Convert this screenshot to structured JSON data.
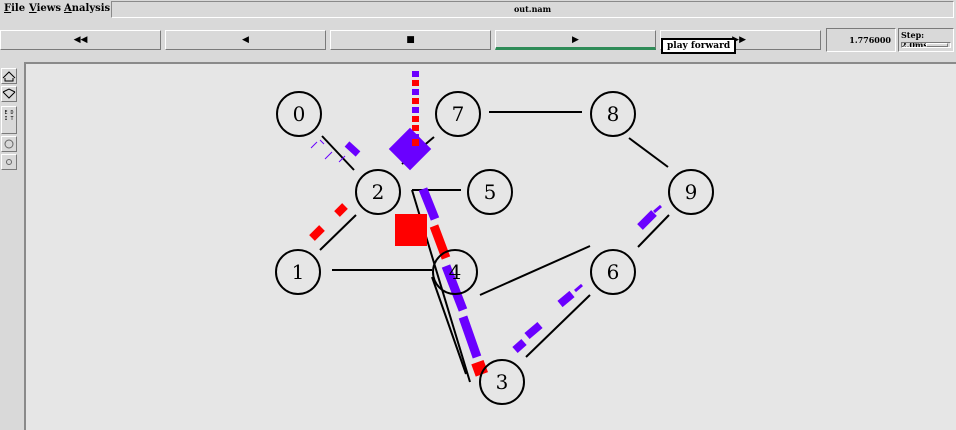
{
  "menu": {
    "file": "File",
    "views": "Views",
    "analysis": "Analysis"
  },
  "window": {
    "title": "out.nam"
  },
  "toolbar": {
    "rewind": "◀◀",
    "back": "◀",
    "stop": "■",
    "play": "▶",
    "fast_forward": "▶▶",
    "time": "1.776000",
    "step_label": "Step: 2.0ms",
    "tooltip": "play forward"
  },
  "colors": {
    "link": "#000000",
    "packet_red": "#ff0000",
    "packet_blue": "#6a00ff",
    "active_button": "#2e8b57"
  },
  "nodes": [
    {
      "id": "0",
      "label": "0"
    },
    {
      "id": "1",
      "label": "1"
    },
    {
      "id": "2",
      "label": "2"
    },
    {
      "id": "3",
      "label": "3"
    },
    {
      "id": "4",
      "label": "4"
    },
    {
      "id": "5",
      "label": "5"
    },
    {
      "id": "6",
      "label": "6"
    },
    {
      "id": "7",
      "label": "7"
    },
    {
      "id": "8",
      "label": "8"
    },
    {
      "id": "9",
      "label": "9"
    }
  ],
  "links": [
    [
      "0",
      "2"
    ],
    [
      "1",
      "2"
    ],
    [
      "1",
      "4"
    ],
    [
      "2",
      "5"
    ],
    [
      "2",
      "7"
    ],
    [
      "2",
      "3"
    ],
    [
      "7",
      "8"
    ],
    [
      "8",
      "9"
    ],
    [
      "9",
      "6"
    ],
    [
      "6",
      "4"
    ],
    [
      "6",
      "3"
    ],
    [
      "4",
      "3"
    ]
  ]
}
